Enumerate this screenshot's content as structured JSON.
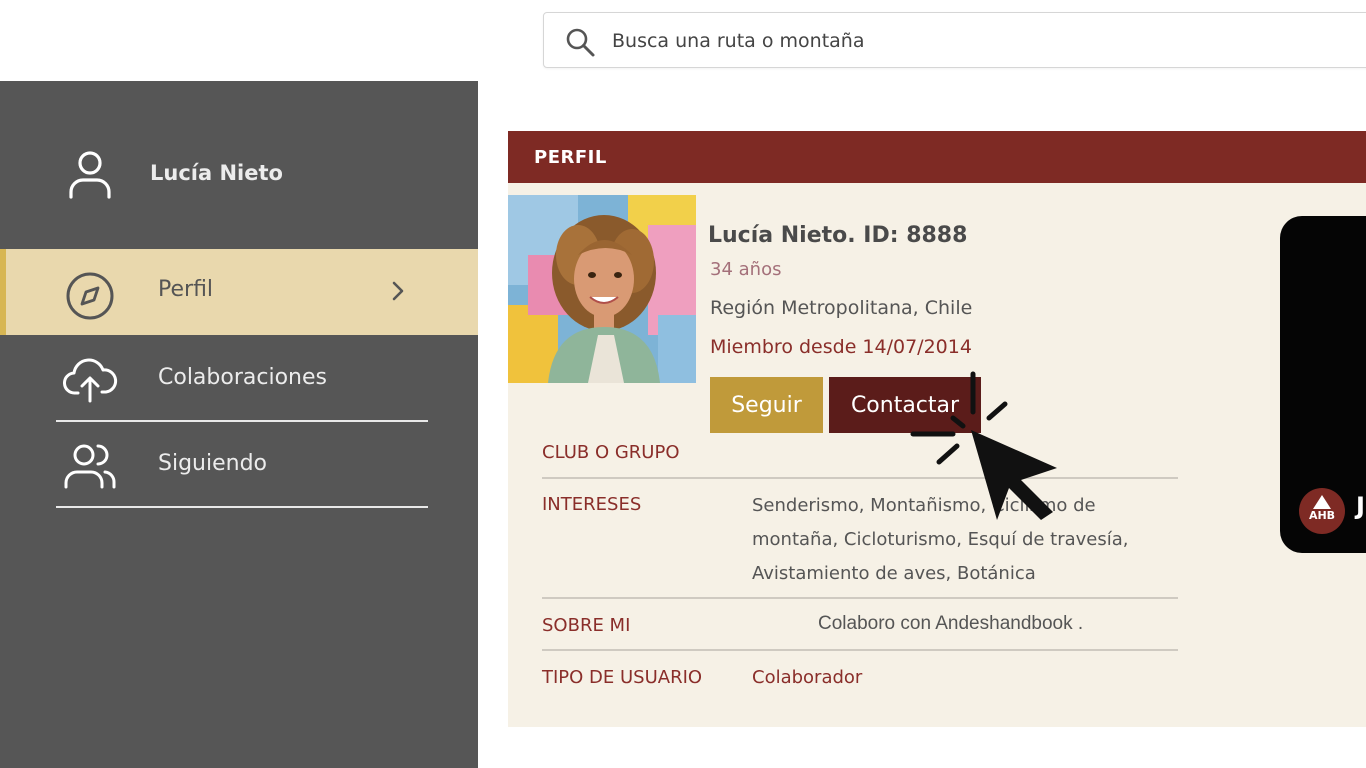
{
  "search": {
    "placeholder": "Busca una ruta o montaña"
  },
  "sidebar": {
    "user_name": "Lucía Nieto",
    "items": [
      {
        "label": "Perfil",
        "active": true
      },
      {
        "label": "Colaboraciones"
      },
      {
        "label": "Siguiendo"
      }
    ]
  },
  "profile": {
    "header": "PERFIL",
    "name": "Lucía Nieto. ID: 8888",
    "age": "34 años",
    "region": "Región Metropolitana, Chile",
    "member_since": "Miembro desde 14/07/2014",
    "follow_label": "Seguir",
    "contact_label": "Contactar",
    "rows": [
      {
        "label": "CLUB O GRUPO",
        "value": ""
      },
      {
        "label": "INTERESES",
        "value_lines": [
          "Senderismo, Montañismo, Ciclismo de",
          "montaña, Cicloturismo, Esquí de travesía,",
          "Avistamiento de aves, Botánica"
        ]
      },
      {
        "label": "SOBRE MI",
        "value": "Colaboro con Andeshandbook ."
      },
      {
        "label": "TIPO DE USUARIO",
        "value": "Colaborador"
      }
    ]
  },
  "card": {
    "logo_text": "AHB",
    "partial_text": "J"
  },
  "colors": {
    "sidebar_bg": "#565656",
    "active_item_bg": "#e9d8ad",
    "header_bg": "#7e2a24",
    "follow_button": "#c09a3a",
    "contact_button": "#5b1c1a",
    "panel_bg": "#f6f1e6"
  },
  "icons": [
    "search-icon",
    "user-icon",
    "compass-icon",
    "chevron-right-icon",
    "cloud-upload-icon",
    "users-icon",
    "cursor-icon",
    "click-burst-icon"
  ]
}
